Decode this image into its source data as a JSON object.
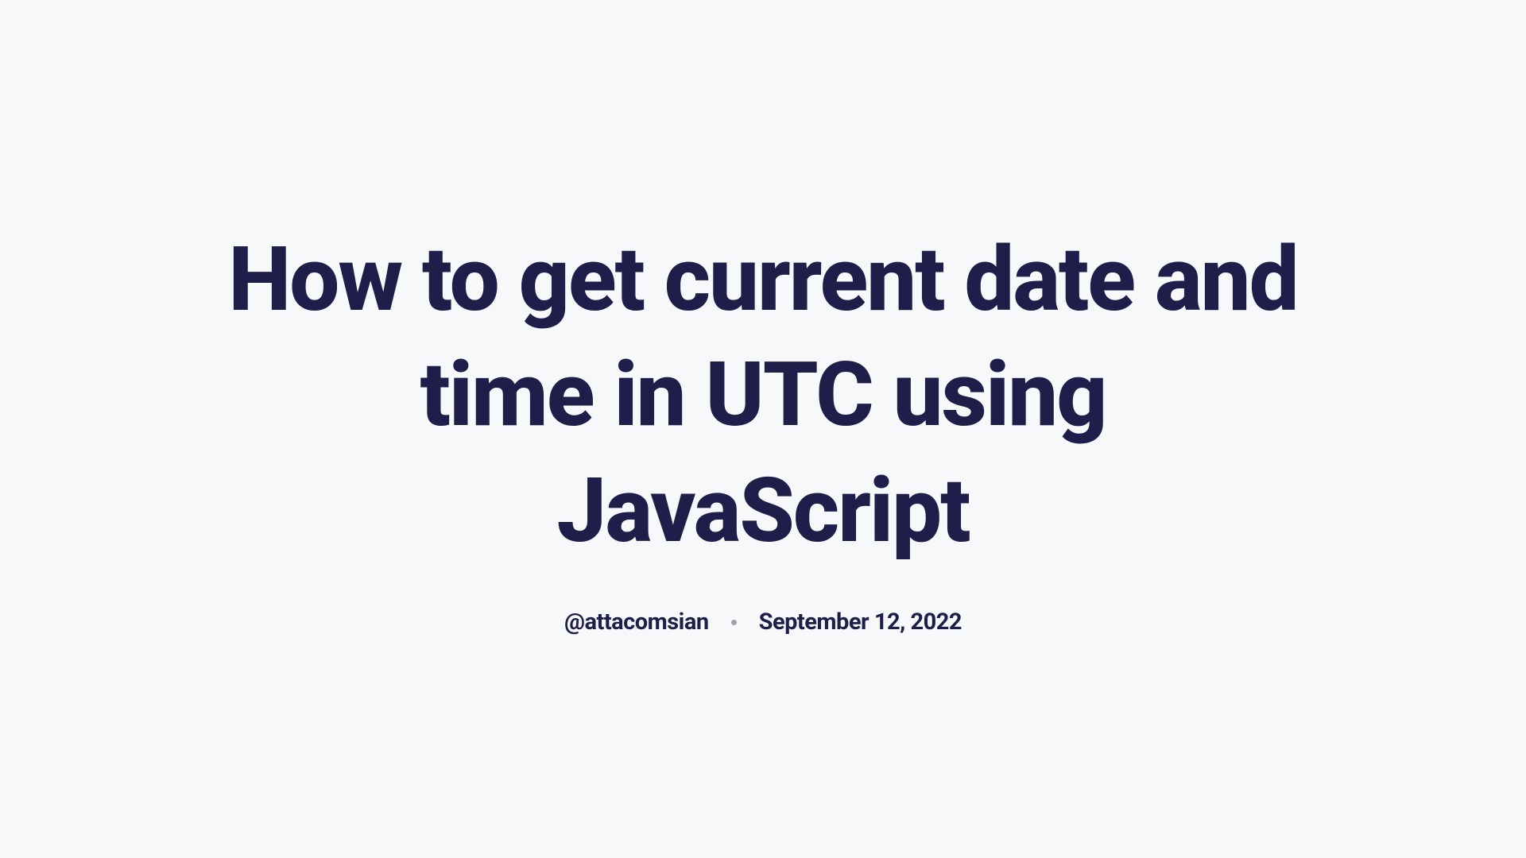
{
  "article": {
    "title": "How to get current date and time in UTC using JavaScript",
    "author": "@attacomsian",
    "date": "September 12, 2022"
  }
}
